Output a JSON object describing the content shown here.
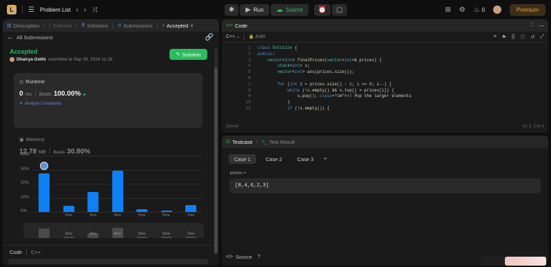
{
  "topbar": {
    "problem_list": "Problem List",
    "run": "Run",
    "submit": "Submit",
    "flame_count": "0",
    "premium": "Premium"
  },
  "left_tabs": [
    {
      "label": "Description"
    },
    {
      "label": "Editorial"
    },
    {
      "label": "Solutions"
    },
    {
      "label": "Submissions"
    },
    {
      "label": "Accepted"
    }
  ],
  "submission": {
    "back_label": "All Submissions",
    "status": "Accepted",
    "user": "Dhairya Gothi",
    "submitted_at": "submitted at Sep 29, 2024 11:28",
    "solution_button": "Solution",
    "runtime_title": "Runtime",
    "runtime_value": "0",
    "runtime_unit": "ms",
    "beats_label": "Beats",
    "runtime_beats": "100.00%",
    "analyze": "Analyze Complexity",
    "memory_title": "Memory",
    "memory_value": "12.78",
    "memory_unit": "MB",
    "memory_beats": "30.80%",
    "code_label": "Code",
    "lang_label": "C++"
  },
  "chart_data": {
    "type": "bar",
    "categories": [
      "",
      "2ms",
      "3ms",
      "4ms",
      "5ms",
      "6ms",
      "7ms"
    ],
    "values": [
      27.5,
      4.5,
      14,
      29.5,
      2,
      1.2,
      5
    ],
    "ylim": [
      0,
      40
    ],
    "yticks": [
      "0%",
      "10%",
      "20%",
      "30%",
      "40%"
    ],
    "mini_labels": [
      "",
      "2ms",
      "3ms",
      "4ms",
      "5ms",
      "6ms",
      "7ms"
    ]
  },
  "editor": {
    "title": "Code",
    "language": "C++",
    "auto": "Auto",
    "saved": "Saved",
    "cursor": "Ln 1, Col 1",
    "lines": [
      "class Solution {",
      "public:",
      "    vector<int> finalPrices(vector<int>& prices) {",
      "        stack<int> s;",
      "        vector<int> ans(prices.size());",
      "",
      "        for (int i = prices.size() - 1; i >= 0; i--) {",
      "            while (!s.empty() && s.top() > prices[i]) {",
      "                s.pop(); // Pop the larger elements",
      "            }",
      "            if (!s.empty()) {"
    ]
  },
  "testcase": {
    "tab_testcase": "Testcase",
    "tab_result": "Test Result",
    "cases": [
      "Case 1",
      "Case 2",
      "Case 3"
    ],
    "var_label": "prices =",
    "var_value": "[8,4,6,2,3]",
    "source_label": "Source"
  },
  "colors": {
    "accent": "#2cbb5d",
    "bar": "#0f7ff6",
    "premium": "#ffa116"
  }
}
